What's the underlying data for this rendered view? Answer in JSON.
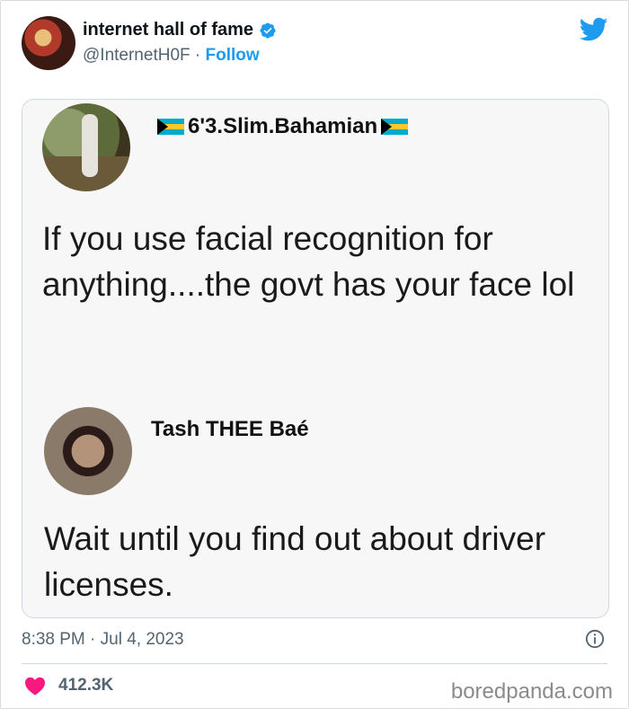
{
  "tweet": {
    "author_name": "internet hall of fame",
    "author_handle": "@InternetH0F",
    "separator": "·",
    "follow_label": "Follow",
    "timestamp": "8:38 PM · Jul 4, 2023",
    "likes": "412.3K"
  },
  "embedded_posts": [
    {
      "name": "6'3.Slim.Bahamian",
      "text": "If you use facial recognition for anything....the govt has your face lol"
    },
    {
      "name": "Tash THEE Baé",
      "text": "Wait until you find out about driver licenses."
    }
  ],
  "watermark": "boredpanda.com",
  "colors": {
    "accent": "#1d9bf0",
    "heart": "#f91880",
    "muted": "#536471"
  },
  "icons": [
    "verified-icon",
    "twitter-bird-icon",
    "info-icon",
    "heart-icon",
    "bahamas-flag-icon"
  ]
}
